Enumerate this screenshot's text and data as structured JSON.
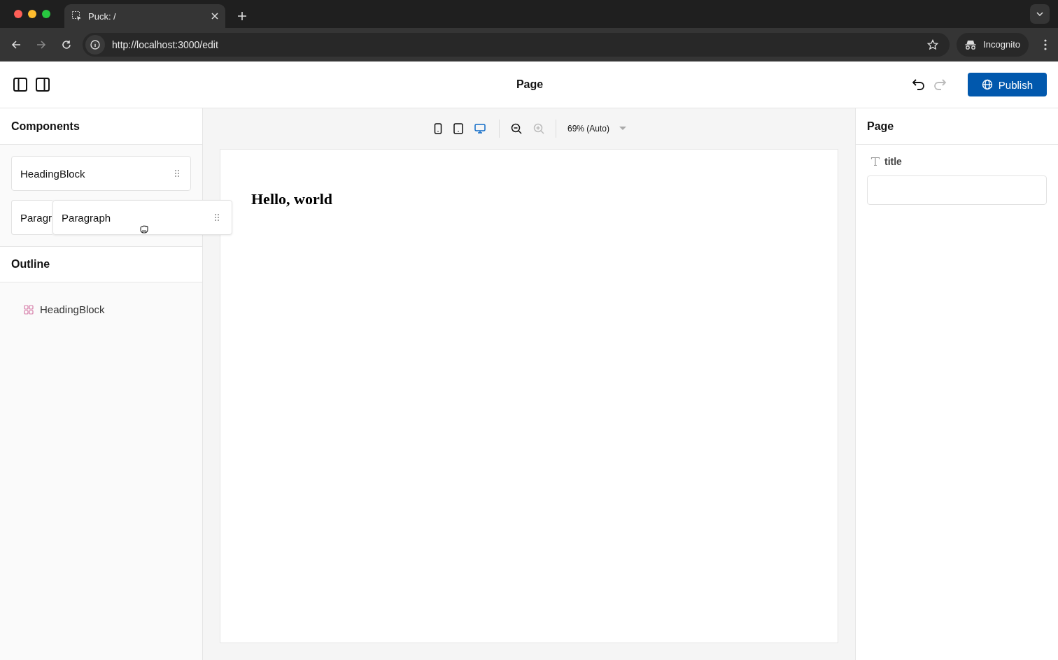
{
  "browser": {
    "tab_title": "Puck: /",
    "url": "http://localhost:3000/edit",
    "profile": "Incognito"
  },
  "header": {
    "title": "Page",
    "publish": "Publish",
    "undo_disabled": false,
    "redo_disabled": true
  },
  "components": {
    "heading": "Components",
    "items": [
      {
        "label": "HeadingBlock"
      },
      {
        "label": "Paragr"
      }
    ],
    "drag_preview": {
      "label": "Paragraph"
    }
  },
  "outline": {
    "heading": "Outline",
    "items": [
      {
        "label": "HeadingBlock"
      }
    ]
  },
  "canvas_toolbar": {
    "viewports": [
      {
        "kind": "mobile",
        "selected": false
      },
      {
        "kind": "tablet",
        "selected": false
      },
      {
        "kind": "desktop",
        "selected": true
      }
    ],
    "zoom_out_disabled": false,
    "zoom_in_disabled": true,
    "zoom": "69% (Auto)"
  },
  "canvas": {
    "heading": "Hello, world"
  },
  "fields": {
    "heading": "Page",
    "items": [
      {
        "label": "title"
      }
    ]
  }
}
